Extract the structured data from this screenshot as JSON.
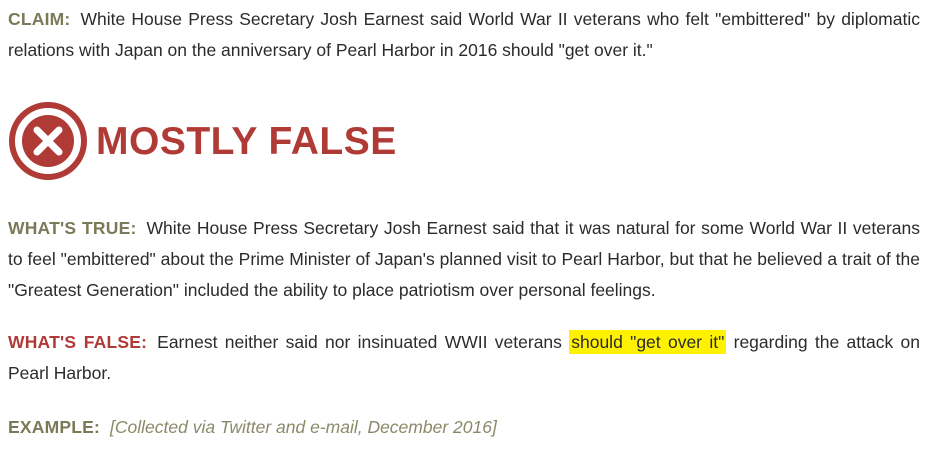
{
  "claim": {
    "label": "CLAIM:",
    "text": "White House Press Secretary Josh Earnest said World War II veterans who felt \"embittered\" by diplomatic relations with Japan on the anniversary of Pearl Harbor in 2016 should \"get over it.\""
  },
  "rating": {
    "icon": "x-circle-icon",
    "text": "MOSTLY FALSE",
    "color": "#b03a36"
  },
  "whats_true": {
    "label": "WHAT'S TRUE:",
    "text": "White House Press Secretary Josh Earnest said that it was natural for some World War II veterans to feel \"embittered\" about the Prime Minister of Japan's planned visit to Pearl Harbor, but that he believed a trait of the \"Greatest Generation\" included the ability to place patriotism over personal feelings."
  },
  "whats_false": {
    "label": "WHAT'S FALSE:",
    "text_before": "Earnest neither said nor insinuated WWII veterans ",
    "text_highlight": "should \"get over it\"",
    "text_after": " regarding the attack on Pearl Harbor.",
    "highlight_color": "#fff200"
  },
  "example": {
    "label": "EXAMPLE:",
    "text": "[Collected via Twitter and e-mail, December 2016]"
  },
  "colors": {
    "label_olive": "#7a7a58",
    "label_red": "#b03a36",
    "body_text": "#2b2b2b"
  }
}
